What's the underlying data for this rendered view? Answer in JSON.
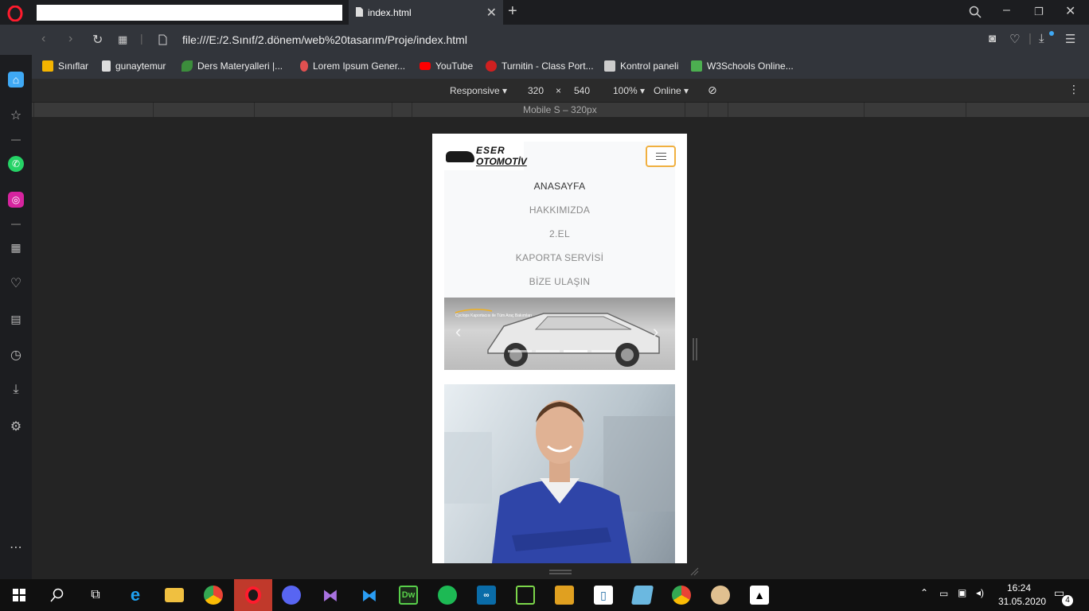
{
  "browser": {
    "tab_title": "index.html",
    "url": "file:///E:/2.Sınıf/2.dönem/web%20tasarım/Proje/index.html"
  },
  "bookmarks": [
    {
      "label": "Sınıflar",
      "icon": "classroom-icon",
      "color": "#f4b400"
    },
    {
      "label": "gunaytemur",
      "icon": "document-icon",
      "color": "#dddddd"
    },
    {
      "label": "Ders Materyalleri |...",
      "icon": "leaf-icon",
      "color": "#3c8d3c"
    },
    {
      "label": "Lorem Ipsum Gener...",
      "icon": "pin-icon",
      "color": "#e05050"
    },
    {
      "label": "YouTube",
      "icon": "youtube-icon",
      "color": "#ff0000"
    },
    {
      "label": "Turnitin - Class Port...",
      "icon": "turnitin-icon",
      "color": "#d02020"
    },
    {
      "label": "Kontrol paneli",
      "icon": "bookmark-page-icon",
      "color": "#cccccc"
    },
    {
      "label": "W3Schools Online...",
      "icon": "w3schools-icon",
      "color": "#4caf50"
    }
  ],
  "devtools": {
    "device": "Responsive",
    "width": "320",
    "times": "×",
    "height": "540",
    "zoom": "100%",
    "network": "Online",
    "media_label": "Mobile S – 320px"
  },
  "site": {
    "logo_line1": "ESER",
    "logo_line2": "OTOMOTİV",
    "menu": [
      "ANASAYFA",
      "HAKKIMIZDA",
      "2.EL",
      "KAPORTA SERVİSİ",
      "BİZE ULAŞIN"
    ],
    "slider_caption": "Cyclops Kaportacısı ile Tüm Araç Bakımları"
  },
  "taskbar": {
    "time": "16:24",
    "date": "31.05.2020",
    "notifications": "4"
  }
}
